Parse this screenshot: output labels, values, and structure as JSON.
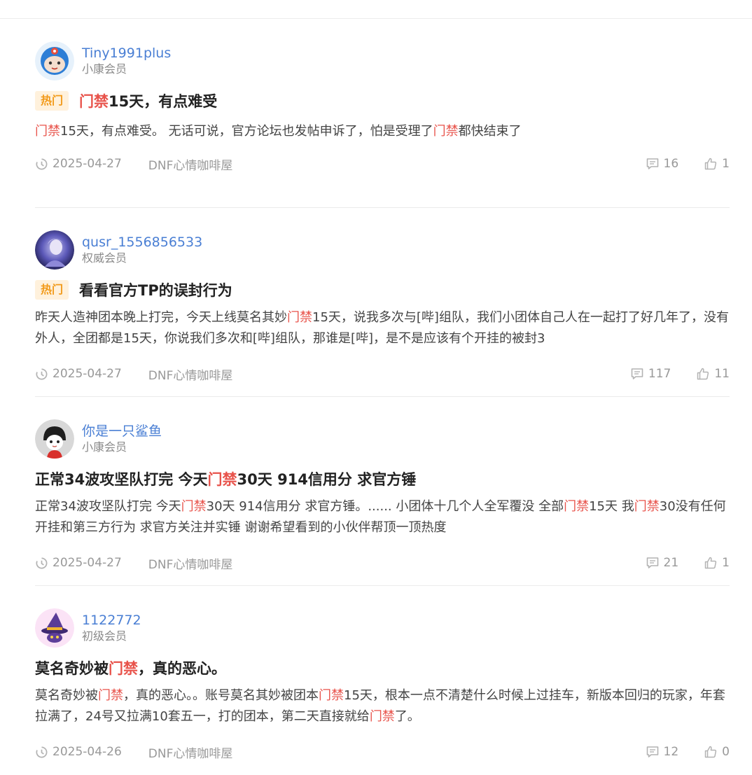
{
  "posts": [
    {
      "username": "Tiny1991plus",
      "level": "小康会员",
      "hot_label": "热门",
      "title_parts": [
        {
          "text": "门禁",
          "hl": true
        },
        {
          "text": "15天，有点难受",
          "hl": false
        }
      ],
      "excerpt_parts": [
        {
          "text": "门禁",
          "hl": true
        },
        {
          "text": "15天，有点难受。 无话可说，官方论坛也发帖申诉了，怕是受理了",
          "hl": false
        },
        {
          "text": "门禁",
          "hl": true
        },
        {
          "text": "都快结束了",
          "hl": false
        }
      ],
      "date": "2025-04-27",
      "category": "DNF心情咖啡屋",
      "comments": "16",
      "likes": "1"
    },
    {
      "username": "qusr_1556856533",
      "level": "权威会员",
      "hot_label": "热门",
      "title_parts": [
        {
          "text": "看看官方TP的误封行为",
          "hl": false
        }
      ],
      "excerpt_parts": [
        {
          "text": "昨天人造神团本晚上打完，今天上线莫名其妙",
          "hl": false
        },
        {
          "text": "门禁",
          "hl": true
        },
        {
          "text": "15天，说我多次与[哔]组队，我们小团体自己人在一起打了好几年了，没有外人，全团都是15天，你说我们多次和[哔]组队，那谁是[哔]，是不是应该有个开挂的被封3",
          "hl": false
        }
      ],
      "date": "2025-04-27",
      "category": "DNF心情咖啡屋",
      "comments": "117",
      "likes": "11"
    },
    {
      "username": "你是一只鲨鱼",
      "level": "小康会员",
      "hot_label": "",
      "title_parts": [
        {
          "text": "正常34波攻坚队打完 今天",
          "hl": false
        },
        {
          "text": "门禁",
          "hl": true
        },
        {
          "text": "30天 914信用分 求官方锤",
          "hl": false
        }
      ],
      "excerpt_parts": [
        {
          "text": "正常34波攻坚队打完 今天",
          "hl": false
        },
        {
          "text": "门禁",
          "hl": true
        },
        {
          "text": "30天 914信用分 求官方锤。...... 小团体十几个人全军覆没 全部",
          "hl": false
        },
        {
          "text": "门禁",
          "hl": true
        },
        {
          "text": "15天 我",
          "hl": false
        },
        {
          "text": "门禁",
          "hl": true
        },
        {
          "text": "30没有任何开挂和第三方行为 求官方关注并实锤 谢谢希望看到的小伙伴帮顶一顶热度",
          "hl": false
        }
      ],
      "date": "2025-04-27",
      "category": "DNF心情咖啡屋",
      "comments": "21",
      "likes": "1"
    },
    {
      "username": "1122772",
      "level": "初级会员",
      "hot_label": "",
      "title_parts": [
        {
          "text": "莫名奇妙被",
          "hl": false
        },
        {
          "text": "门禁",
          "hl": true
        },
        {
          "text": "，真的恶心。",
          "hl": false
        }
      ],
      "excerpt_parts": [
        {
          "text": "莫名奇妙被",
          "hl": false
        },
        {
          "text": "门禁",
          "hl": true
        },
        {
          "text": "，真的恶心。。账号莫名其妙被团本",
          "hl": false
        },
        {
          "text": "门禁",
          "hl": true
        },
        {
          "text": "15天，根本一点不清楚什么时候上过挂车，新版本回归的玩家，年套拉满了，24号又拉满10套五一，打的团本，第二天直接就给",
          "hl": false
        },
        {
          "text": "门禁",
          "hl": true
        },
        {
          "text": "了。",
          "hl": false
        }
      ],
      "date": "2025-04-26",
      "category": "DNF心情咖啡屋",
      "comments": "12",
      "likes": "0"
    }
  ],
  "colors": {
    "username": "#4a7fd4",
    "highlight": "#e8534b",
    "hot_badge_text": "#f29a1a",
    "hot_badge_bg": "#fff1dc",
    "meta": "#999999"
  },
  "icons": [
    "clock-icon",
    "comment-icon",
    "thumbs-up-icon",
    "avatar-icon"
  ]
}
